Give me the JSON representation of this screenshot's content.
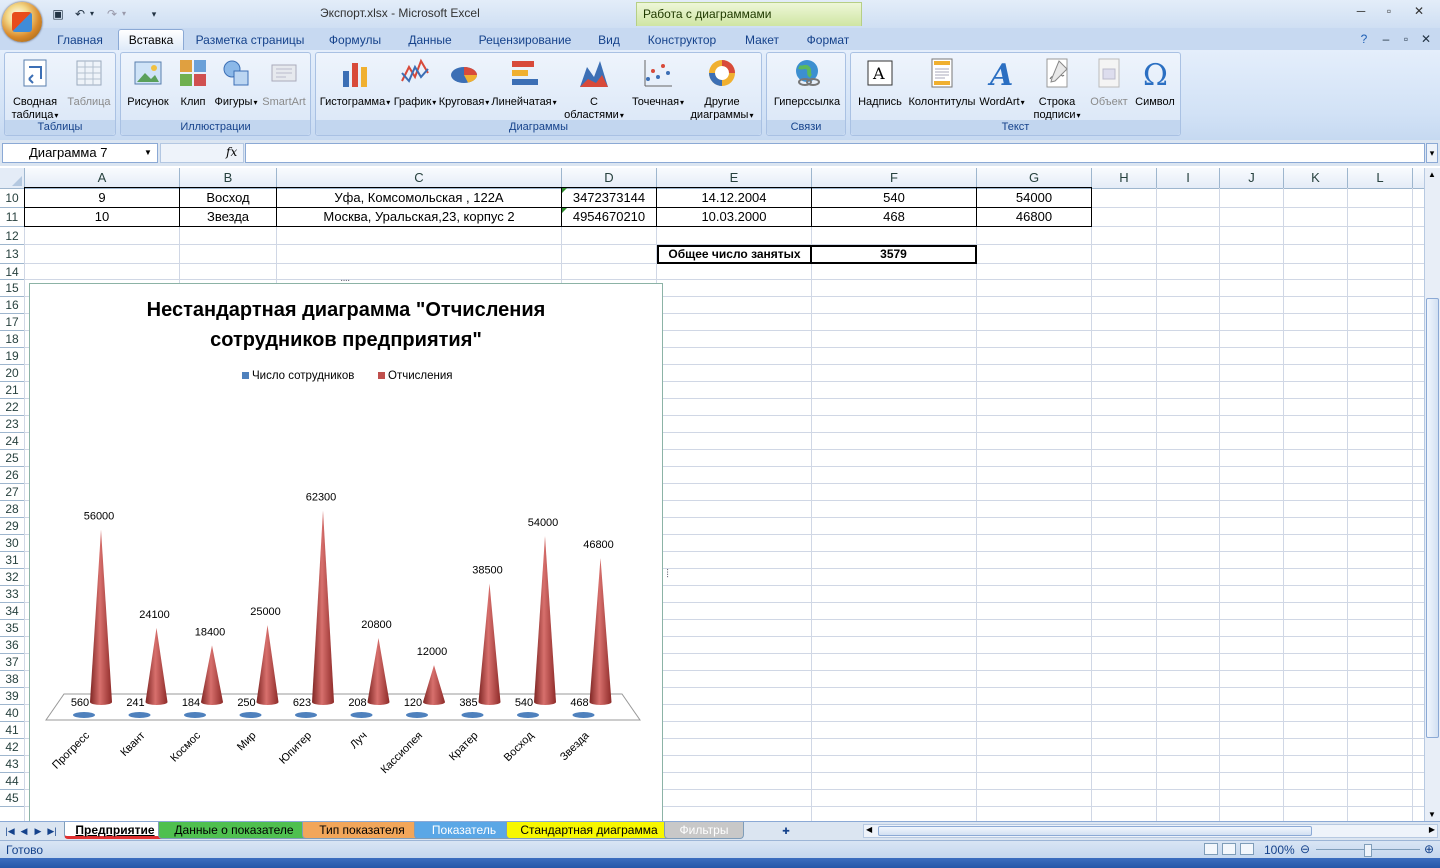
{
  "window": {
    "title": "Экспорт.xlsx - Microsoft Excel",
    "context_tab": "Работа с диаграммами"
  },
  "ribbon_tabs": [
    "Главная",
    "Вставка",
    "Разметка страницы",
    "Формулы",
    "Данные",
    "Рецензирование",
    "Вид",
    "Конструктор",
    "Макет",
    "Формат"
  ],
  "active_tab": "Вставка",
  "groups": {
    "tables": {
      "label": "Таблицы",
      "buttons": [
        "Сводная\nтаблица",
        "Таблица"
      ]
    },
    "illustrations": {
      "label": "Иллюстрации",
      "buttons": [
        "Рисунок",
        "Клип",
        "Фигуры",
        "SmartArt"
      ]
    },
    "charts": {
      "label": "Диаграммы",
      "buttons": [
        "Гистограмма",
        "График",
        "Круговая",
        "Линейчатая",
        "С\nобластями",
        "Точечная",
        "Другие\nдиаграммы"
      ]
    },
    "links": {
      "label": "Связи",
      "buttons": [
        "Гиперссылка"
      ]
    },
    "text": {
      "label": "Текст",
      "buttons": [
        "Надпись",
        "Колонтитулы",
        "WordArt",
        "Строка\nподписи",
        "Объект",
        "Символ"
      ]
    }
  },
  "formula_bar": {
    "name_box": "Диаграмма 7",
    "fx": "fx",
    "formula": ""
  },
  "columns": [
    "A",
    "B",
    "C",
    "D",
    "E",
    "F",
    "G",
    "H",
    "I",
    "J",
    "K",
    "L"
  ],
  "rows": [
    "10",
    "11",
    "12",
    "13",
    "14",
    "15",
    "16",
    "17",
    "18",
    "19",
    "20",
    "21",
    "22",
    "23",
    "24",
    "25",
    "26",
    "27",
    "28",
    "29",
    "30",
    "31",
    "32",
    "33",
    "34",
    "35",
    "36",
    "37",
    "38",
    "39",
    "40",
    "41",
    "42",
    "43",
    "44",
    "45"
  ],
  "table_rows": [
    [
      "9",
      "Восход",
      "Уфа, Комсомольская , 122А",
      "3472373144",
      "14.12.2004",
      "540",
      "54000"
    ],
    [
      "10",
      "Звезда",
      "Москва, Уральская,23, корпус 2",
      "4954670210",
      "10.03.2000",
      "468",
      "46800"
    ]
  ],
  "total": {
    "label": "Общее число занятых",
    "value": "3579"
  },
  "chart_data": {
    "type": "bar",
    "title": "Нестандартная диаграмма \"Отчисления сотрудников предприятия\"",
    "title_lines": [
      "Нестандартная диаграмма \"Отчисления",
      "сотрудников предприятия\""
    ],
    "legend_position": "top",
    "categories": [
      "Прогресс",
      "Квант",
      "Космос",
      "Мир",
      "Юпитер",
      "Луч",
      "Кассиопея",
      "Кратер",
      "Восход",
      "Звезда"
    ],
    "series": [
      {
        "name": "Число сотрудников",
        "color": "#4f81bd",
        "values": [
          560,
          241,
          184,
          250,
          623,
          208,
          120,
          385,
          540,
          468
        ]
      },
      {
        "name": "Отчисления",
        "color": "#c0504d",
        "values": [
          56000,
          24100,
          18400,
          25000,
          62300,
          20800,
          12000,
          38500,
          54000,
          46800
        ]
      }
    ]
  },
  "sheet_tabs": [
    {
      "label": "Предприятие",
      "color": "#ffffff",
      "accent": "#e03030",
      "active": true
    },
    {
      "label": "Данные о показателе",
      "color": "#4fc04f"
    },
    {
      "label": "Тип показателя",
      "color": "#f2a65a"
    },
    {
      "label": "Показатель",
      "color": "#5aa7e6"
    },
    {
      "label": "Стандартная диаграмма",
      "color": "#f7f700"
    },
    {
      "label": "Фильтры",
      "color": "#c8c8c8"
    }
  ],
  "status": {
    "text": "Готово",
    "zoom": "100%"
  }
}
